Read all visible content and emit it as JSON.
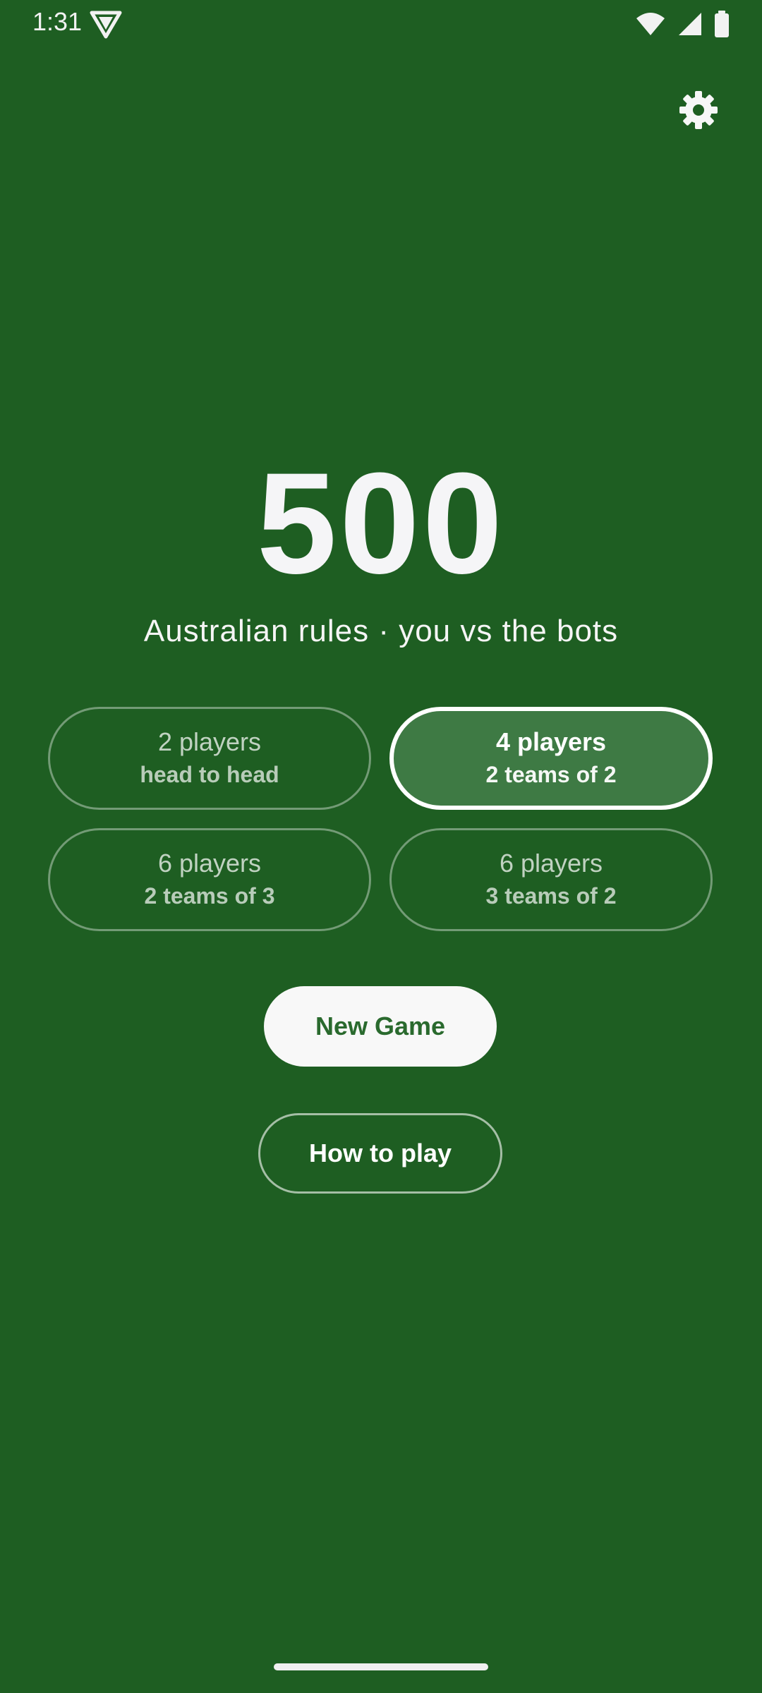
{
  "status_bar": {
    "time": "1:31",
    "icons": [
      "vpn-shield-icon",
      "wifi-icon",
      "cell-signal-icon",
      "battery-icon"
    ]
  },
  "header": {
    "settings_icon": "gear-icon"
  },
  "main": {
    "title": "500",
    "subtitle": "Australian rules · you vs the bots",
    "modes": [
      {
        "count": "2 players",
        "desc": "head to head",
        "selected": false
      },
      {
        "count": "4 players",
        "desc": "2 teams of 2",
        "selected": true
      },
      {
        "count": "6 players",
        "desc": "2 teams of 3",
        "selected": false
      },
      {
        "count": "6 players",
        "desc": "3 teams of 2",
        "selected": false
      }
    ],
    "new_game_label": "New Game",
    "how_to_play_label": "How to play"
  },
  "colors": {
    "background": "#1e5e22",
    "selected_fill": "#3e7a44",
    "primary_button_bg": "#f8f8f8",
    "primary_button_text": "#2a6a2e"
  }
}
